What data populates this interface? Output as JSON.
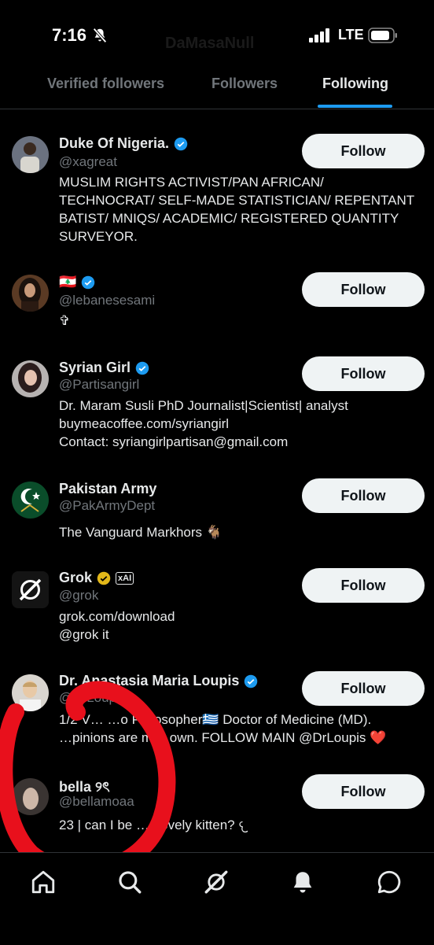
{
  "status": {
    "time": "7:16",
    "carrier": "LTE"
  },
  "header": {
    "ghost_title": "DaMasaNull"
  },
  "tabs": [
    {
      "label": "Verified followers",
      "active": false
    },
    {
      "label": "Followers",
      "active": false
    },
    {
      "label": "Following",
      "active": true
    }
  ],
  "accent_color": "#1d9bf0",
  "users": [
    {
      "name": "Duke Of Nigeria.",
      "handle": "@xagreat",
      "verified": "blue",
      "bio": "MUSLIM RIGHTS ACTIVIST/PAN AFRICAN/\nTECHNOCRAT/ SELF-MADE STATISTICIAN/ REPENTANT\nBATIST/ MNIQS/ ACADEMIC/ REGISTERED QUANTITY\nSURVEYOR.",
      "button": "Follow"
    },
    {
      "name": "🇱🇧",
      "handle": "@lebanesesami",
      "verified": "blue",
      "bio": "✞",
      "button": "Follow"
    },
    {
      "name": "Syrian Girl",
      "handle": "@Partisangirl",
      "verified": "blue",
      "bio": "Dr. Maram Susli PhD Journalist|Scientist| analyst\nbuymeacoffee.com/syriangirl\nContact: syriangirlpartisan@gmail.com",
      "button": "Follow"
    },
    {
      "name": "Pakistan Army",
      "handle": "@PakArmyDept",
      "verified": "none",
      "bio": "The Vanguard Markhors 🐐",
      "button": "Follow"
    },
    {
      "name": "Grok",
      "handle": "@grok",
      "verified": "gold",
      "affiliate": "xAI",
      "bio": "grok.com/download\n@grok it",
      "button": "Follow"
    },
    {
      "name": "Dr. Anastasia Maria Loupis",
      "handle": "@DrLoupis__",
      "verified": "blue",
      "bio": "1/2 V… …o Philosopher🇬🇷 Doctor of Medicine (MD).\n…pinions are m… own. FOLLOW MAIN @DrLoupis ❤️",
      "button": "Follow"
    },
    {
      "name": "bella ୨ৎ",
      "handle": "@bellamoaa",
      "verified": "none",
      "bio": "23 | can I be …r lovely kitten? 𐔌",
      "button": "Follow"
    }
  ],
  "nav": [
    "home-icon",
    "search-icon",
    "grok-icon",
    "notifications-icon",
    "messages-icon"
  ]
}
